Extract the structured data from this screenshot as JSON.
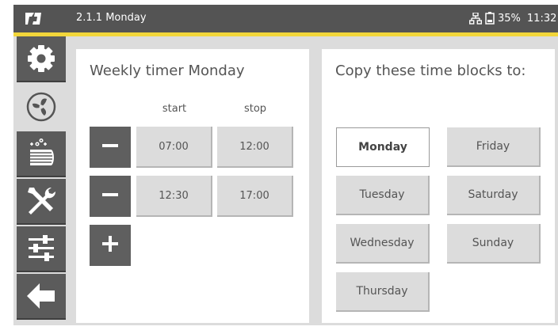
{
  "topbar": {
    "breadcrumb": "2.1.1 Monday",
    "battery_percent": "35%",
    "clock": "11:32",
    "accent_color": "#f2d63a",
    "icons": [
      "logo-icon",
      "network-icon",
      "battery-icon"
    ]
  },
  "sidebar": {
    "items": [
      {
        "name": "settings",
        "icon": "gear-icon",
        "active": false
      },
      {
        "name": "ventilation",
        "icon": "fan-icon",
        "active": true
      },
      {
        "name": "filter",
        "icon": "filter-icon",
        "active": false
      },
      {
        "name": "service",
        "icon": "tools-icon",
        "active": false
      },
      {
        "name": "adjustments",
        "icon": "sliders-icon",
        "active": false
      },
      {
        "name": "back",
        "icon": "back-arrow-icon",
        "active": false
      }
    ]
  },
  "timer": {
    "title": "Weekly timer Monday",
    "start_label": "start",
    "stop_label": "stop",
    "blocks": [
      {
        "start": "07:00",
        "stop": "12:00"
      },
      {
        "start": "12:30",
        "stop": "17:00"
      }
    ]
  },
  "copy": {
    "title": "Copy these time blocks to:",
    "days": [
      {
        "label": "Monday",
        "selected": true
      },
      {
        "label": "Tuesday",
        "selected": false
      },
      {
        "label": "Wednesday",
        "selected": false
      },
      {
        "label": "Thursday",
        "selected": false
      },
      {
        "label": "Friday",
        "selected": false
      },
      {
        "label": "Saturday",
        "selected": false
      },
      {
        "label": "Sunday",
        "selected": false
      }
    ]
  }
}
